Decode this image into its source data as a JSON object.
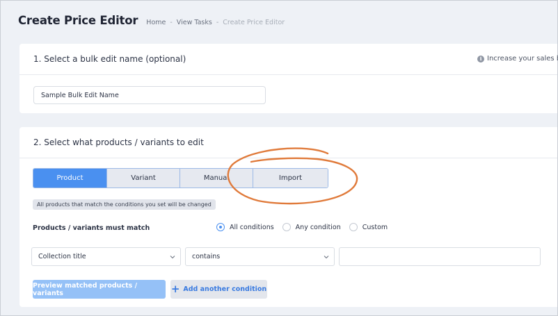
{
  "header": {
    "title": "Create Price Editor",
    "breadcrumb": {
      "home": "Home",
      "sep": "-",
      "tasks": "View Tasks",
      "current": "Create Price Editor"
    }
  },
  "step1": {
    "title": "1. Select a bulk edit name (optional)",
    "info_icon": "info-icon",
    "info_text": "Increase your sales by",
    "name_value": "Sample Bulk Edit Name"
  },
  "step2": {
    "title": "2. Select what products / variants to edit",
    "tabs": [
      {
        "label": "Product",
        "active": true
      },
      {
        "label": "Variant",
        "active": false
      },
      {
        "label": "Manual",
        "active": false
      },
      {
        "label": "Import",
        "active": false
      }
    ],
    "hint": "All products that match the conditions you set will be changed",
    "match_label": "Products / variants must match",
    "radios": [
      {
        "label": "All conditions",
        "checked": true
      },
      {
        "label": "Any condition",
        "checked": false
      },
      {
        "label": "Custom",
        "checked": false
      }
    ],
    "field_select": "Collection title",
    "operator_select": "contains",
    "condition_value": "",
    "preview_button": "Preview matched products / variants",
    "add_condition_button": "Add another condition",
    "add_icon": "plus-icon"
  },
  "colors": {
    "primary": "#4a90f0",
    "primary_disabled": "#95c1f7",
    "annotation": "#e07a3a",
    "background": "#eef1f6"
  }
}
